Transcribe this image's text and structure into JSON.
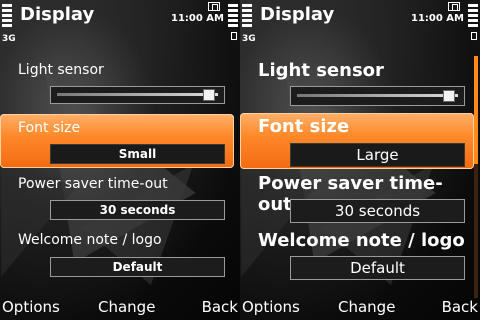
{
  "colors": {
    "selection": "#ff8a2a",
    "selection_highlight": "#ffb069",
    "scrollbar_thumb": "#ff8a1a",
    "text": "#ffffff",
    "value_box": "#1c1c1c"
  },
  "screens": [
    {
      "title": "Display",
      "network": "3G",
      "time": "11:00 AM",
      "icons": [
        "signal-strength-icon",
        "message-icon",
        "battery-level-icon"
      ],
      "settings": [
        {
          "label": "Light sensor",
          "type": "slider",
          "level": 1.0
        },
        {
          "label": "Font size",
          "value": "Small",
          "selected": true
        },
        {
          "label": "Power saver time-out",
          "value": "30 seconds"
        },
        {
          "label": "Welcome note / logo",
          "value": "Default"
        }
      ],
      "softkeys": {
        "left": "Options",
        "middle": "Change",
        "right": "Back"
      }
    },
    {
      "title": "Display",
      "network": "3G",
      "time": "11:00 AM",
      "icons": [
        "signal-strength-icon",
        "message-icon",
        "battery-level-icon"
      ],
      "settings": [
        {
          "label": "Light sensor",
          "type": "slider",
          "level": 1.0
        },
        {
          "label": "Font size",
          "value": "Large",
          "selected": true
        },
        {
          "label": "Power saver time-out",
          "value": "30 seconds"
        },
        {
          "label": "Welcome note / logo",
          "value": "Default"
        }
      ],
      "softkeys": {
        "left": "Options",
        "middle": "Change",
        "right": "Back"
      }
    }
  ]
}
